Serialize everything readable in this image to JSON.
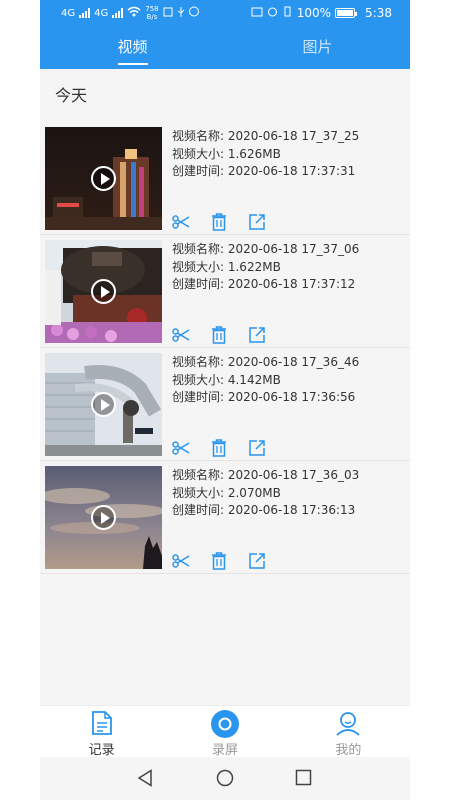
{
  "status_bar": {
    "network_left": "4G",
    "network_right": "4G",
    "speed_value": "758",
    "speed_unit": "B/s",
    "battery": "100%",
    "time": "5:38"
  },
  "tabs": [
    {
      "label": "视频",
      "active": true
    },
    {
      "label": "图片",
      "active": false
    }
  ],
  "section_date": "今天",
  "videos": [
    {
      "name_label": "视频名称: 2020-06-18 17_37_25",
      "size_label": "视频大小: 1.626MB",
      "created_label": "创建时间: 2020-06-18 17:37:31"
    },
    {
      "name_label": "视频名称: 2020-06-18 17_37_06",
      "size_label": "视频大小: 1.622MB",
      "created_label": "创建时间: 2020-06-18 17:37:12"
    },
    {
      "name_label": "视频名称: 2020-06-18 17_36_46",
      "size_label": "视频大小: 4.142MB",
      "created_label": "创建时间: 2020-06-18 17:36:56"
    },
    {
      "name_label": "视频名称: 2020-06-18 17_36_03",
      "size_label": "视频大小: 2.070MB",
      "created_label": "创建时间: 2020-06-18 17:36:13"
    }
  ],
  "item_actions": [
    "scissors-icon",
    "trash-icon",
    "share-icon"
  ],
  "bottom_nav": [
    {
      "label": "记录",
      "icon": "document-icon",
      "active": true
    },
    {
      "label": "录屏",
      "icon": "record-icon",
      "active": false
    },
    {
      "label": "我的",
      "icon": "profile-icon",
      "active": false
    }
  ],
  "colors": {
    "primary": "#2a95ee",
    "background": "#f5f5f5"
  }
}
